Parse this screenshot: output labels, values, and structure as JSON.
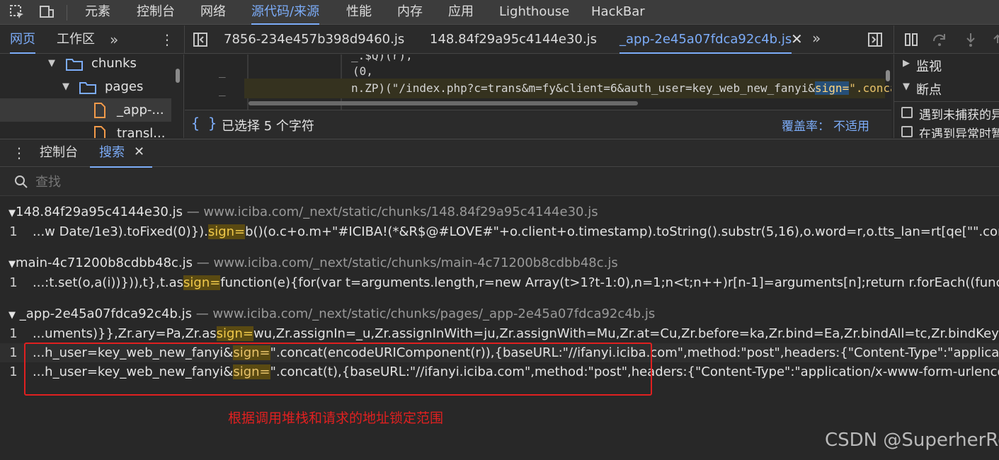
{
  "toolbar": {
    "tabs": [
      "元素",
      "控制台",
      "网络",
      "源代码/来源",
      "性能",
      "内存",
      "应用",
      "Lighthouse",
      "HackBar"
    ]
  },
  "navigator": {
    "tabs": [
      "网页",
      "工作区"
    ],
    "tree": [
      {
        "label": "chunks"
      },
      {
        "label": "pages"
      },
      {
        "label": "_app-..."
      },
      {
        "label": "transl..."
      }
    ]
  },
  "editor": {
    "tabs": [
      "7856-234e457b398d9460.js",
      "148.84f29a95c4144e30.js",
      "_app-2e45a07fdca92c4b.js"
    ],
    "code_line_1": "_.$Q)(r),",
    "code_line_2": "(0,",
    "code_line_3_prefix": "n.ZP)(\"/index.php?c=trans&m=fy&client=6&auth_user=key_web_new_fanyi&",
    "code_line_3_hl": "sign=",
    "code_line_3_suffix": "\".concat(er",
    "status_selected": "已选择 5 个字符",
    "coverage_label": "覆盖率：",
    "coverage_value": "不适用"
  },
  "debugger": {
    "sections": [
      "监视",
      "断点"
    ],
    "checkbox_1": "遇到未捕获的异常时暂停",
    "checkbox_2": "在遇到异常时暂停"
  },
  "drawer": {
    "tabs": [
      "控制台",
      "搜索"
    ],
    "search_placeholder": "查找"
  },
  "results": [
    {
      "file": "148.84f29a95c4144e30.js",
      "path": "— www.iciba.com/_next/static/chunks/148.84f29a95c4144e30.js",
      "lines": [
        {
          "num": "1",
          "pre": "...w Date/1e3).toFixed(0)}).",
          "hl": "sign=",
          "post": "b()(o.c+o.m+\"#ICIBA!(*&R$@#LOVE#\"+o.client+o.timestamp).toString().substr(5,16),o.word=r,o.tts_lan=rt[qe[\"\".concat(t,\"Type"
        }
      ]
    },
    {
      "file": "main-4c71200b8cdbb48c.js",
      "path": "— www.iciba.com/_next/static/chunks/main-4c71200b8cdbb48c.js",
      "lines": [
        {
          "num": "1",
          "pre": "...:t.set(o,a(i))})),t},t.as",
          "hl": "sign=",
          "post": "function(e){for(var t=arguments.length,r=new Array(t>1?t-1:0),n=1;n<t;n++)r[n-1]=arguments[n];return r.forEach((function(t){Array.f"
        }
      ]
    },
    {
      "file": "_app-2e45a07fdca92c4b.js",
      "path": "— www.iciba.com/_next/static/chunks/pages/_app-2e45a07fdca92c4b.js",
      "lines": [
        {
          "num": "1",
          "pre": "...uments)}},Zr.ary=Pa,Zr.as",
          "hl": "sign=",
          "post": "wu,Zr.assignIn=_u,Zr.assignInWith=ju,Zr.assignWith=Mu,Zr.at=Cu,Zr.before=ka,Zr.bind=Ea,Zr.bindAll=tc,Zr.bindKey=Na,Zr.castA"
        },
        {
          "num": "1",
          "pre": "...h_user=key_web_new_fanyi&",
          "hl": "sign=",
          "post": "\".concat(encodeURIComponent(r)),{baseURL:\"//ifanyi.iciba.com\",method:\"post\",headers:{\"Content-Type\":\"application/x-ww"
        },
        {
          "num": "1",
          "pre": "...h_user=key_web_new_fanyi&",
          "hl": "sign=",
          "post": "\".concat(t),{baseURL:\"//ifanyi.iciba.com\",method:\"post\",headers:{\"Content-Type\":\"application/x-www-form-urlencoded\"},da"
        }
      ]
    }
  ],
  "annotation": "根据调用堆栈和请求的地址锁定范围",
  "watermark": "CSDN @SuperherRo",
  "colors": {
    "accent": "#7cacf8",
    "highlight": "#5a4a12",
    "annotation": "#e02020"
  }
}
